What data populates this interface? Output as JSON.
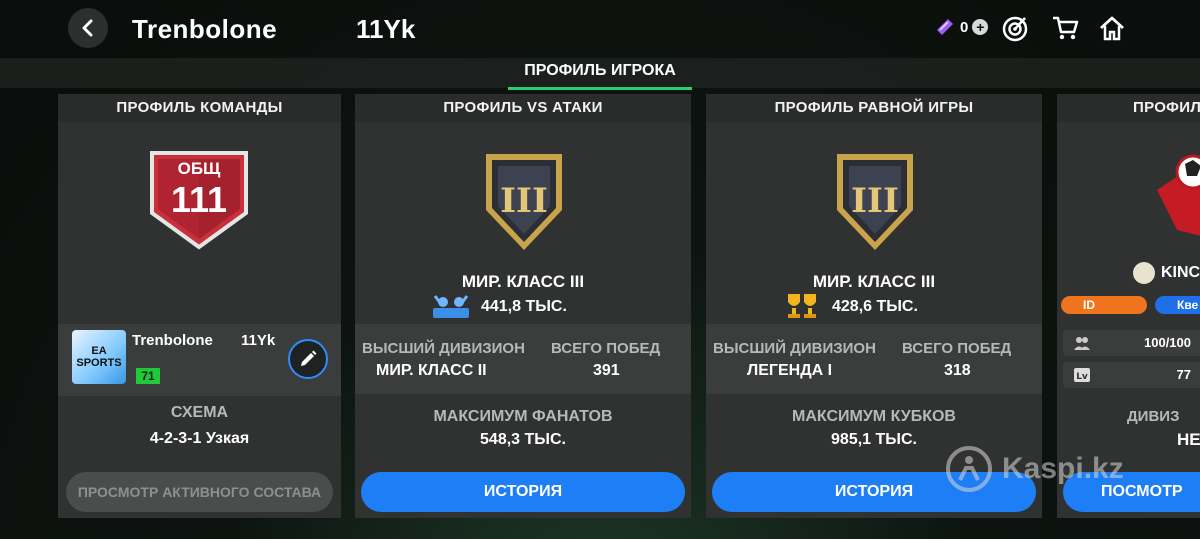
{
  "header": {
    "player_name": "Trenbolone",
    "player_tag": "11Yk",
    "gems_count": "0",
    "icons": [
      "back-icon",
      "gem-icon",
      "plus-icon",
      "target-icon",
      "cart-icon",
      "home-icon"
    ]
  },
  "tabs": {
    "active": "ПРОФИЛЬ ИГРОКА"
  },
  "team_card": {
    "title": "ПРОФИЛЬ КОМАНДЫ",
    "overall_label": "ОБЩ",
    "overall_value": "111",
    "team_name": "Trenbolone",
    "team_tag": "11Yk",
    "logo_text": "EA SPORTS",
    "level": "71",
    "schema_label": "СХЕМА",
    "schema_value": "4-2-3-1 Узкая",
    "button": "ПРОСМОТР АКТИВНОГО СОСТАВА"
  },
  "vs_card": {
    "title": "ПРОФИЛЬ VS АТАКИ",
    "rank_roman": "III",
    "rank": "МИР. КЛАСС III",
    "score": "441,8 ТЫС.",
    "best_division_label": "ВЫСШИЙ ДИВИЗИОН",
    "best_division_value": "МИР. КЛАСС II",
    "wins_label": "ВСЕГО ПОБЕД",
    "wins_value": "391",
    "max_label": "МАКСИМУМ ФАНАТОВ",
    "max_value": "548,3 ТЫС.",
    "button": "ИСТОРИЯ"
  },
  "eq_card": {
    "title": "ПРОФИЛЬ РАВНОЙ ИГРЫ",
    "rank_roman": "III",
    "rank": "МИР. КЛАСС III",
    "score": "428,6 ТЫС.",
    "best_division_label": "ВЫСШИЙ ДИВИЗИОН",
    "best_division_value": "ЛЕГЕНДА I",
    "wins_label": "ВСЕГО ПОБЕД",
    "wins_value": "318",
    "max_label": "МАКСИМУМ КУБКОВ",
    "max_value": "985,1 ТЫС.",
    "button": "ИСТОРИЯ"
  },
  "club_card": {
    "title": "ПРОФИЛ",
    "name": "KINC",
    "pill_id": "ID",
    "pill_quest": "Кве",
    "members": "100/100",
    "level": "77",
    "division_label": "ДИВИЗ",
    "division_value": "НЕ",
    "button": "ПОСМОТР"
  },
  "watermark": {
    "text": "Kaspi.kz"
  },
  "colors": {
    "accent_green": "#2ecc71",
    "button_blue": "#1e7ef5",
    "shield_red": "#c8303a",
    "badge_gold": "#c9a44a"
  }
}
